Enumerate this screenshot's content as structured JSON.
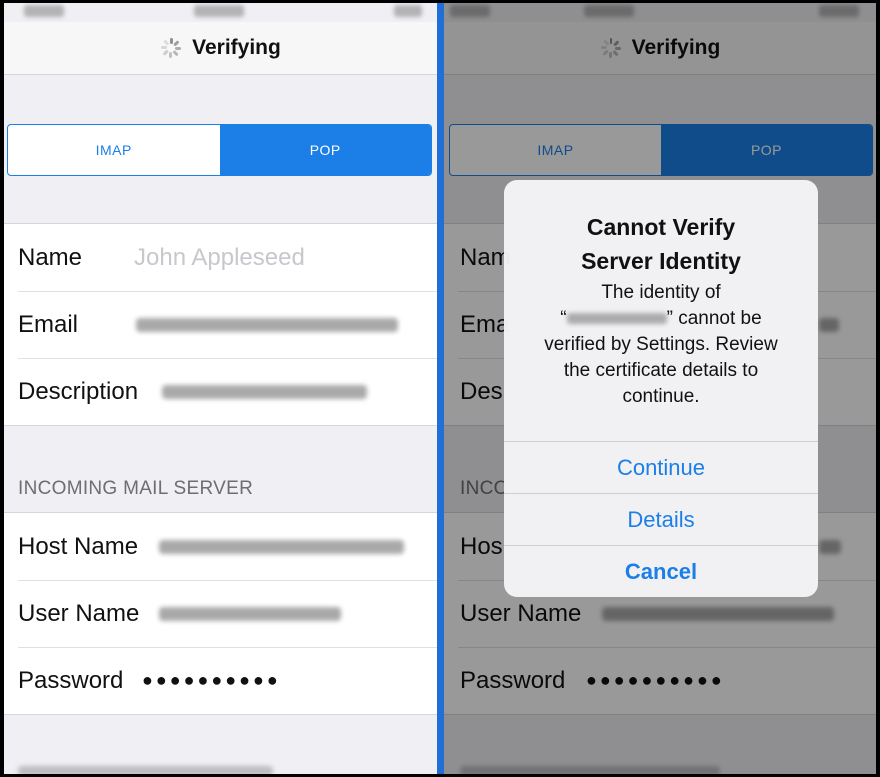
{
  "screen_left": {
    "nav_title": "Verifying",
    "segment": {
      "imap": "IMAP",
      "pop": "POP",
      "selected": "POP"
    },
    "account": {
      "name_label": "Name",
      "name_placeholder": "John Appleseed",
      "email_label": "Email",
      "description_label": "Description"
    },
    "incoming_header": "INCOMING MAIL SERVER",
    "incoming": {
      "host_label": "Host Name",
      "user_label": "User Name",
      "password_label": "Password",
      "password_dots": "●●●●●●●●●●"
    }
  },
  "screen_right": {
    "nav_title": "Verifying",
    "segment": {
      "imap": "IMAP",
      "pop": "POP",
      "selected": "POP"
    },
    "account": {
      "name_label": "Nam",
      "email_label": "Ema",
      "description_label": "Des"
    },
    "incoming_header": "INCO",
    "incoming": {
      "host_label": "Hos",
      "user_label": "User Name",
      "password_label": "Password",
      "password_dots": "●●●●●●●●●●"
    },
    "alert": {
      "title_line1": "Cannot Verify",
      "title_line2": "Server Identity",
      "message_line1": "The identity of",
      "message_quote_open": "“",
      "message_quote_close": "” cannot be",
      "message_line3": "verified by Settings. Review",
      "message_line4": "the certificate details to",
      "message_line5": "continue.",
      "buttons": {
        "continue": "Continue",
        "details": "Details",
        "cancel": "Cancel"
      }
    }
  },
  "colors": {
    "accent": "#1b7fe7",
    "divider": "#1f6fd6",
    "background": "#efeff4"
  },
  "icons": {
    "activity": "spinner-icon"
  }
}
